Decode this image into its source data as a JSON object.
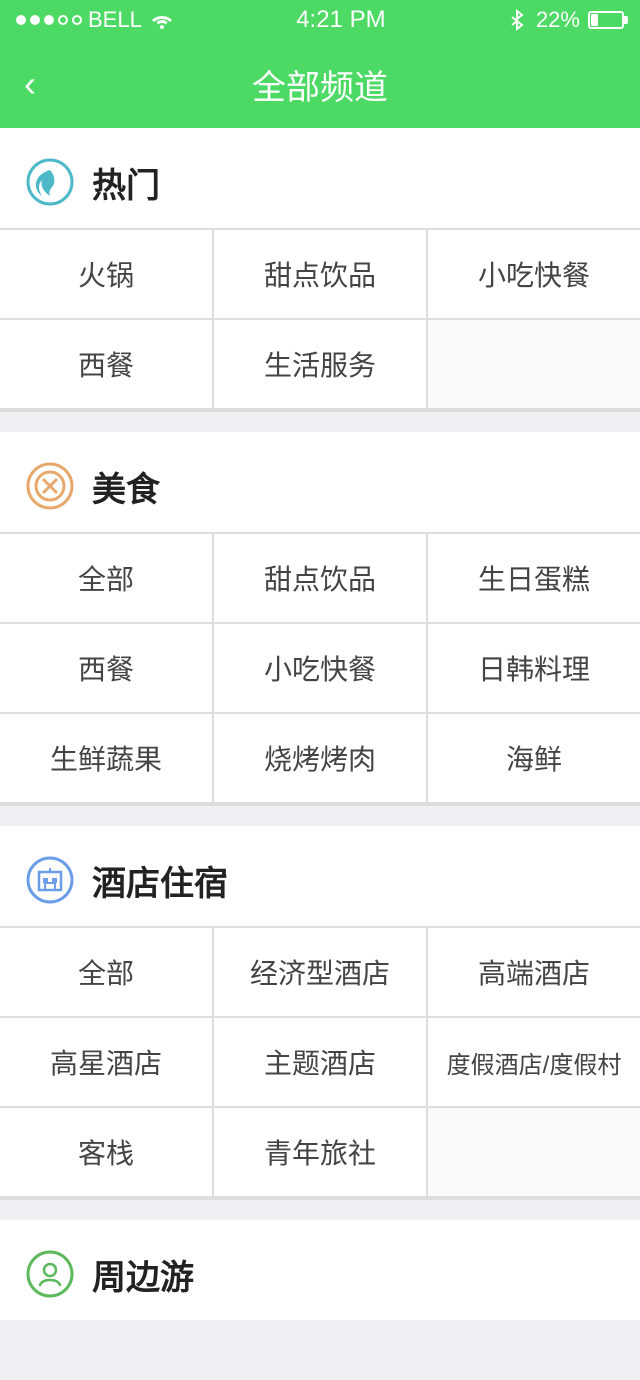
{
  "statusBar": {
    "carrier": "BELL",
    "time": "4:21 PM",
    "battery": "22%"
  },
  "header": {
    "backLabel": "‹",
    "title": "全部频道"
  },
  "sections": [
    {
      "id": "hot",
      "iconType": "hot",
      "title": "热门",
      "items": [
        "火锅",
        "甜点饮品",
        "小吃快餐",
        "西餐",
        "生活服务"
      ]
    },
    {
      "id": "food",
      "iconType": "food",
      "title": "美食",
      "items": [
        "全部",
        "甜点饮品",
        "生日蛋糕",
        "西餐",
        "小吃快餐",
        "日韩料理",
        "生鲜蔬果",
        "烧烤烤肉",
        "海鲜"
      ]
    },
    {
      "id": "hotel",
      "iconType": "hotel",
      "title": "酒店住宿",
      "items": [
        "全部",
        "经济型酒店",
        "高端酒店",
        "高星酒店",
        "主题酒店",
        "度假酒店/度假村",
        "客栈",
        "青年旅社"
      ]
    },
    {
      "id": "travel",
      "iconType": "travel",
      "title": "周边游",
      "items": []
    }
  ]
}
